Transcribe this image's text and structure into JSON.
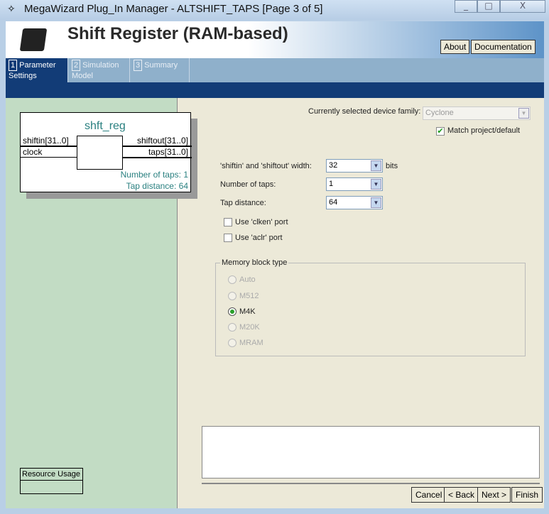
{
  "window": {
    "title": "MegaWizard Plug_In Manager - ALTSHIFT_TAPS [Page 3 of 5]",
    "minimize": "_",
    "maximize": "□",
    "close": "X"
  },
  "header": {
    "title": "Shift Register (RAM-based)",
    "about": "About",
    "documentation": "Documentation"
  },
  "tabs": [
    {
      "num": "1",
      "label": "Parameter Settings"
    },
    {
      "num": "2",
      "label": "Simulation Model"
    },
    {
      "num": "3",
      "label": "Summary"
    }
  ],
  "diagram": {
    "name": "shft_reg",
    "in1": "shiftin[31..0]",
    "in2": "clock",
    "out1": "shiftout[31..0]",
    "out2": "taps[31..0]",
    "info1": "Number of taps: 1",
    "info2": "Tap distance: 64"
  },
  "resource_usage": "Resource Usage",
  "device": {
    "label": "Currently selected device family:",
    "value": "Cyclone",
    "match_label": "Match project/default",
    "match_checked": true
  },
  "params": {
    "width_label": "'shiftin' and 'shiftout' width:",
    "width_value": "32",
    "width_unit": "bits",
    "taps_label": "Number of taps:",
    "taps_value": "1",
    "distance_label": "Tap distance:",
    "distance_value": "64",
    "clken_label": "Use 'clken' port",
    "aclr_label": "Use 'aclr' port"
  },
  "memory": {
    "title": "Memory block type",
    "options": [
      "Auto",
      "M512",
      "M4K",
      "M20K",
      "MRAM"
    ],
    "selected": "M4K"
  },
  "buttons": {
    "cancel": "Cancel",
    "back": "< Back",
    "next": "Next >",
    "finish": "Finish"
  }
}
